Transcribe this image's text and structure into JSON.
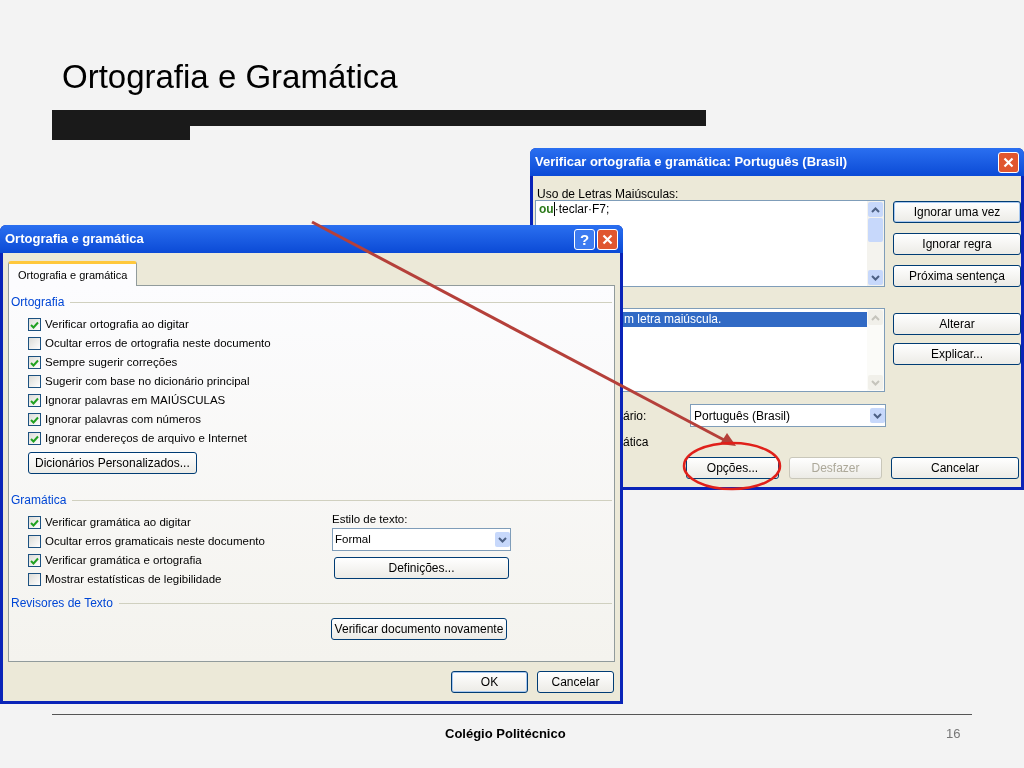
{
  "slide": {
    "title": "Ortografia e Gramática",
    "footer": "Colégio Politécnico",
    "page_number": "16"
  },
  "spelling_dialog": {
    "title": "Verificar ortografia e gramática: Português (Brasil)",
    "sentence_label": "Uso de Letras Maiúsculas:",
    "sentence": [
      {
        "text": "ou",
        "kind": "error"
      },
      {
        "text": "·teclar·F7;",
        "kind": "normal"
      }
    ],
    "side_buttons": [
      {
        "label": "Ignorar uma vez",
        "default": true
      },
      {
        "label": "Ignorar regra",
        "default": false
      },
      {
        "label": "Próxima sentença",
        "default": false
      }
    ],
    "suggestions": [
      {
        "text": "m letra maiúscula.",
        "selected": true
      }
    ],
    "suggestion_buttons": [
      "Alterar",
      "Explicar..."
    ],
    "dictionary_label": "ário:",
    "dictionary_value": "Português (Brasil)",
    "grammar_label": "ática",
    "bottom_buttons": [
      {
        "label": "Opções...",
        "disabled": false
      },
      {
        "label": "Desfazer",
        "disabled": true
      },
      {
        "label": "Cancelar",
        "disabled": false
      }
    ]
  },
  "options_dialog": {
    "title": "Ortografia e gramática",
    "help": "?",
    "tabs": [
      {
        "label": "Ortografia e gramática",
        "selected": true
      }
    ],
    "spelling": {
      "heading": "Ortografia",
      "options": [
        {
          "label": "Verificar ortografia ao digitar",
          "checked": true
        },
        {
          "label": "Ocultar erros de ortografia neste documento",
          "checked": false
        },
        {
          "label": "Sempre sugerir correções",
          "checked": true
        },
        {
          "label": "Sugerir com base no dicionário principal",
          "checked": false
        },
        {
          "label": "Ignorar palavras em MAIÚSCULAS",
          "checked": true
        },
        {
          "label": "Ignorar palavras com números",
          "checked": true
        },
        {
          "label": "Ignorar endereços de arquivo e Internet",
          "checked": true
        }
      ],
      "button": "Dicionários Personalizados..."
    },
    "grammar": {
      "heading": "Gramática",
      "options": [
        {
          "label": "Verificar gramática ao digitar",
          "checked": true
        },
        {
          "label": "Ocultar erros gramaticais neste documento",
          "checked": false
        },
        {
          "label": "Verificar gramática e ortografia",
          "checked": true
        },
        {
          "label": "Mostrar estatísticas de legibilidade",
          "checked": false
        }
      ],
      "style_label": "Estilo de texto:",
      "style_value": "Formal",
      "settings_button": "Definições..."
    },
    "proofing": {
      "heading": "Revisores de Texto",
      "button": "Verificar documento novamente"
    },
    "footer_buttons": [
      {
        "label": "OK",
        "default": true
      },
      {
        "label": "Cancelar",
        "default": false
      }
    ]
  }
}
